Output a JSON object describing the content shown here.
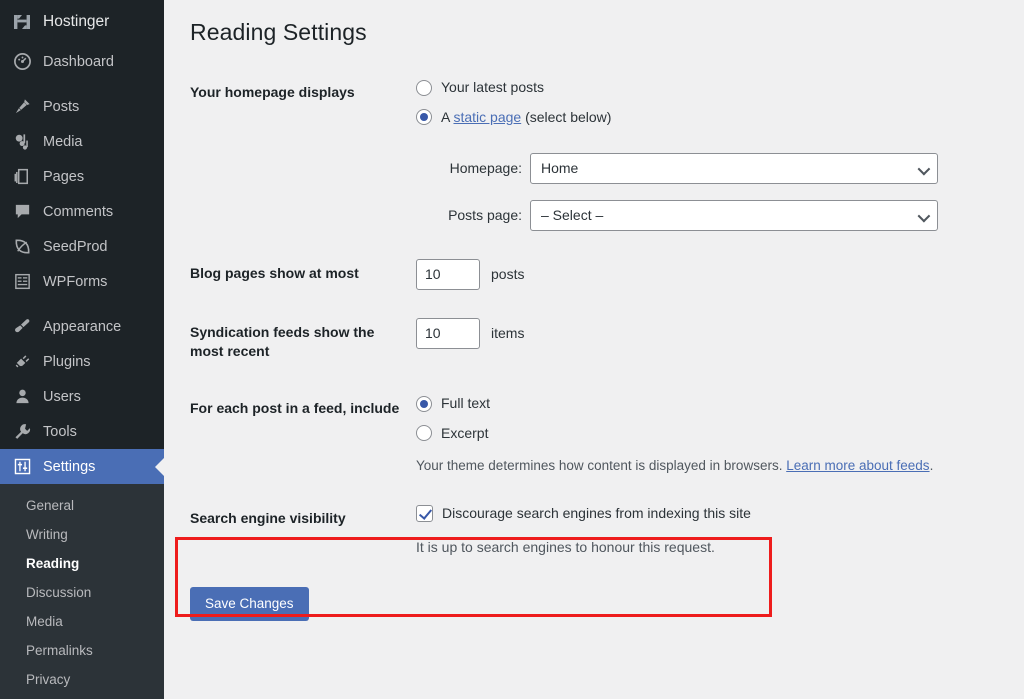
{
  "sidebar": {
    "brand": {
      "label": "Hostinger",
      "icon": "hostinger-logo-icon"
    },
    "items": [
      {
        "label": "Dashboard",
        "icon": "dashboard-icon",
        "gap_before": false,
        "active": false
      },
      {
        "label": "Posts",
        "icon": "pin-icon",
        "gap_before": true,
        "active": false
      },
      {
        "label": "Media",
        "icon": "media-icon",
        "gap_before": false,
        "active": false
      },
      {
        "label": "Pages",
        "icon": "pages-icon",
        "gap_before": false,
        "active": false
      },
      {
        "label": "Comments",
        "icon": "comments-icon",
        "gap_before": false,
        "active": false
      },
      {
        "label": "SeedProd",
        "icon": "seedprod-icon",
        "gap_before": false,
        "active": false
      },
      {
        "label": "WPForms",
        "icon": "wpforms-icon",
        "gap_before": false,
        "active": false
      },
      {
        "label": "Appearance",
        "icon": "paintbrush-icon",
        "gap_before": true,
        "active": false
      },
      {
        "label": "Plugins",
        "icon": "plug-icon",
        "gap_before": false,
        "active": false
      },
      {
        "label": "Users",
        "icon": "user-icon",
        "gap_before": false,
        "active": false
      },
      {
        "label": "Tools",
        "icon": "wrench-icon",
        "gap_before": false,
        "active": false
      },
      {
        "label": "Settings",
        "icon": "settings-sliders-icon",
        "gap_before": false,
        "active": true
      }
    ],
    "submenu": [
      {
        "label": "General",
        "current": false
      },
      {
        "label": "Writing",
        "current": false
      },
      {
        "label": "Reading",
        "current": true
      },
      {
        "label": "Discussion",
        "current": false
      },
      {
        "label": "Media",
        "current": false
      },
      {
        "label": "Permalinks",
        "current": false
      },
      {
        "label": "Privacy",
        "current": false
      }
    ]
  },
  "page": {
    "title": "Reading Settings"
  },
  "homepage_displays": {
    "label": "Your homepage displays",
    "option_latest_posts": "Your latest posts",
    "option_static_prefix": "A ",
    "option_static_link": "static page",
    "option_static_suffix": " (select below)",
    "selected": "static_page",
    "homepage_label": "Homepage:",
    "homepage_value": "Home",
    "posts_page_label": "Posts page:",
    "posts_page_value": "– Select –"
  },
  "blog_pages": {
    "label": "Blog pages show at most",
    "value": "10",
    "unit": "posts"
  },
  "syndication": {
    "label": "Syndication feeds show the most recent",
    "value": "10",
    "unit": "items"
  },
  "feed_include": {
    "label": "For each post in a feed, include",
    "option_full_text": "Full text",
    "option_excerpt": "Excerpt",
    "selected": "full_text",
    "description_text": "Your theme determines how content is displayed in browsers. ",
    "description_link": "Learn more about feeds",
    "description_suffix": "."
  },
  "search_visibility": {
    "label": "Search engine visibility",
    "checkbox_label": "Discourage search engines from indexing this site",
    "checked": true,
    "hint": "It is up to search engines to honour this request."
  },
  "save": {
    "label": "Save Changes"
  },
  "colors": {
    "sidebar_bg": "#1d2327",
    "submenu_bg": "#2c3338",
    "accent_blue": "#4a6eb5",
    "radio_blue": "#3858a8",
    "highlight_red": "#ee1c1c",
    "content_bg": "#f0f0f1"
  }
}
